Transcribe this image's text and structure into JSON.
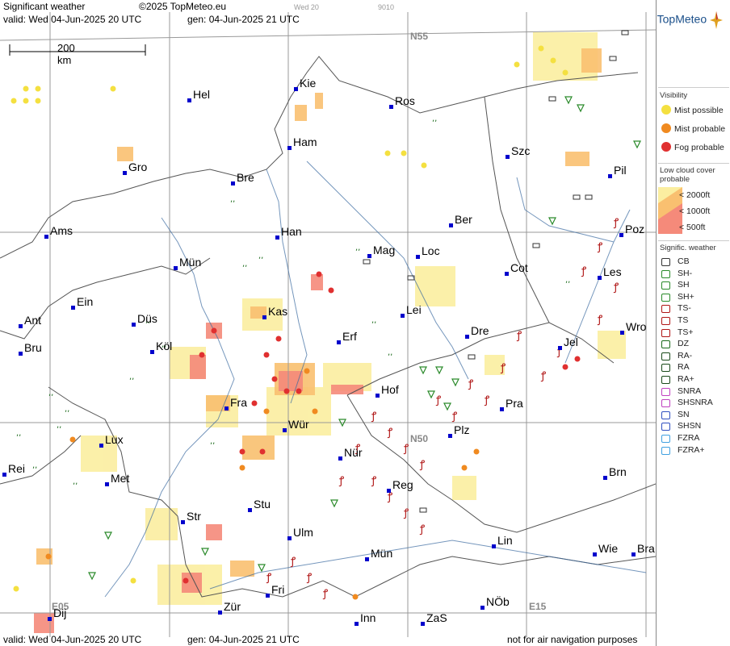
{
  "header": {
    "title": "Significant weather",
    "copyright": "©2025 TopMeteo.eu",
    "valid": "valid:  Wed  04-Jun-2025  20 UTC",
    "gen": "gen: 04-Jun-2025  21 UTC",
    "faint1": "Wed 20",
    "faint2": "9010",
    "logo": "TopMeteo"
  },
  "footer": {
    "valid": "valid:  Wed  04-Jun-2025  20 UTC",
    "gen": "gen: 04-Jun-2025  21 UTC",
    "note": "not for air navigation purposes"
  },
  "scale": {
    "label": "200 km"
  },
  "grid_labels": {
    "n55": "N55",
    "n50": "N50",
    "e05": "E05",
    "e15": "E15"
  },
  "cities": [
    {
      "name": "Hel"
    },
    {
      "name": "Kie"
    },
    {
      "name": "Ros"
    },
    {
      "name": "Ham"
    },
    {
      "name": "Szc"
    },
    {
      "name": "Gro"
    },
    {
      "name": "Bre"
    },
    {
      "name": "Pil"
    },
    {
      "name": "Ber"
    },
    {
      "name": "Ams"
    },
    {
      "name": "Han"
    },
    {
      "name": "Poz"
    },
    {
      "name": "Mag"
    },
    {
      "name": "Loc"
    },
    {
      "name": "Mün"
    },
    {
      "name": "Cot"
    },
    {
      "name": "Les"
    },
    {
      "name": "Ein"
    },
    {
      "name": "Kas"
    },
    {
      "name": "Lei"
    },
    {
      "name": "Ant"
    },
    {
      "name": "Düs"
    },
    {
      "name": "Dre"
    },
    {
      "name": "Wro"
    },
    {
      "name": "Bru"
    },
    {
      "name": "Köl"
    },
    {
      "name": "Erf"
    },
    {
      "name": "Jel"
    },
    {
      "name": "Hof"
    },
    {
      "name": "Fra"
    },
    {
      "name": "Pra"
    },
    {
      "name": "Lux"
    },
    {
      "name": "Wür"
    },
    {
      "name": "Plz"
    },
    {
      "name": "Rei"
    },
    {
      "name": "Nür"
    },
    {
      "name": "Met"
    },
    {
      "name": "Reg"
    },
    {
      "name": "Brn"
    },
    {
      "name": "Stu"
    },
    {
      "name": "Str"
    },
    {
      "name": "Ulm"
    },
    {
      "name": "Lin"
    },
    {
      "name": "Mün"
    },
    {
      "name": "Wie"
    },
    {
      "name": "Bra"
    },
    {
      "name": "Fri"
    },
    {
      "name": "Zür"
    },
    {
      "name": "Inn"
    },
    {
      "name": "ZaS"
    },
    {
      "name": "NÖb"
    },
    {
      "name": "Dij"
    }
  ],
  "legend": {
    "visibility_title": "Visibility",
    "visibility": [
      "Mist possible",
      "Mist probable",
      "Fog probable"
    ],
    "cloud_title": "Low cloud cover probable",
    "cloud": [
      "< 2000ft",
      "< 1000ft",
      "<  500ft"
    ],
    "weather_title": "Signific. weather",
    "weather": [
      "CB",
      "SH-",
      "SH",
      "SH+",
      "TS-",
      "TS",
      "TS+",
      "DZ",
      "RA-",
      "RA",
      "RA+",
      "SNRA",
      "SHSNRA",
      "SN",
      "SHSN",
      "FZRA",
      "FZRA+"
    ],
    "colors": {
      "mist_possible": "#f4e040",
      "mist_probable": "#f08a20",
      "fog": "#e03030",
      "cloud_2000": "#fbeea0",
      "cloud_1000": "#f9c070",
      "cloud_500": "#f58a7a"
    }
  }
}
